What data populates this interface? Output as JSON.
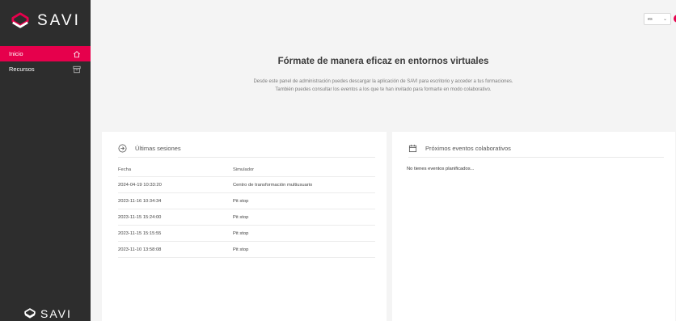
{
  "brand": {
    "name": "SAVI",
    "accent": "#e6004c"
  },
  "sidebar": {
    "items": [
      {
        "label": "Inicio",
        "icon": "home-icon",
        "active": true
      },
      {
        "label": "Recursos",
        "icon": "archive-icon",
        "active": false
      }
    ]
  },
  "header": {
    "language": "es"
  },
  "hero": {
    "title": "Fórmate de manera eficaz en entornos virtuales",
    "line1": "Desde este panel de administración puedes descargar la aplicación de SAVI para escritorio y acceder a tus formaciones.",
    "line2": "También puedes consultar los eventos a los que te han invitado para formarte en modo colaborativo."
  },
  "sessions": {
    "title": "Últimas sesiones",
    "icon": "login-icon",
    "columns": [
      "Fecha",
      "Simulador"
    ],
    "rows": [
      {
        "date": "2024-04-19 10:33:20",
        "sim": "Centro de transformación multiusuario"
      },
      {
        "date": "2023-11-16 10:34:34",
        "sim": "Pit stop"
      },
      {
        "date": "2023-11-15 15:24:00",
        "sim": "Pit stop"
      },
      {
        "date": "2023-11-15 15:15:55",
        "sim": "Pit stop"
      },
      {
        "date": "2023-11-10 13:58:08",
        "sim": "Pit stop"
      }
    ]
  },
  "events": {
    "title": "Próximos eventos colaborativos",
    "icon": "calendar-icon",
    "empty": "No tienes eventos planificados..."
  }
}
